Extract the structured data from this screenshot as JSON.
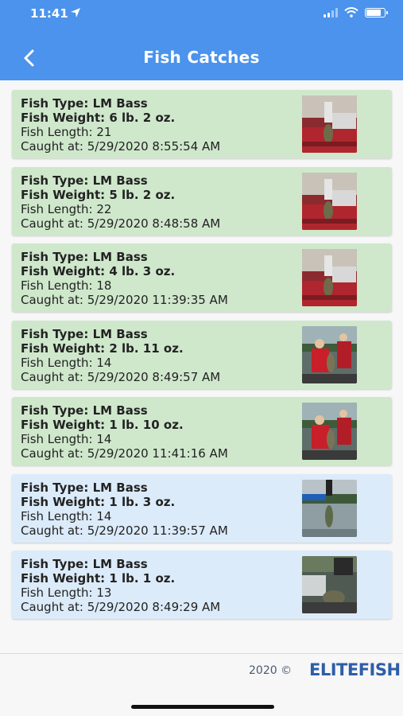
{
  "status": {
    "time": "11:41"
  },
  "header": {
    "title": "Fish Catches"
  },
  "colors": {
    "header": "#4b93ed",
    "card_green": "#cfe8cc",
    "card_blue": "#dcebfa",
    "brand": "#2d5ea8"
  },
  "catches": [
    {
      "type": "Fish Type: LM Bass",
      "weight": "Fish Weight: 6 lb. 2 oz.",
      "length": "Fish Length: 21",
      "caught": "Caught at: 5/29/2020 8:55:54 AM",
      "variant": "green",
      "photo": "fish-on-scale-photo"
    },
    {
      "type": "Fish Type: LM Bass",
      "weight": "Fish Weight: 5 lb. 2 oz.",
      "length": "Fish Length: 22",
      "caught": "Caught at: 5/29/2020 8:48:58 AM",
      "variant": "green",
      "photo": "fish-on-scale-photo"
    },
    {
      "type": "Fish Type: LM Bass",
      "weight": "Fish Weight: 4 lb. 3 oz.",
      "length": "Fish Length: 18",
      "caught": "Caught at: 5/29/2020 11:39:35 AM",
      "variant": "green",
      "photo": "fish-on-scale-photo"
    },
    {
      "type": "Fish Type: LM Bass",
      "weight": "Fish Weight: 2 lb. 11 oz.",
      "length": "Fish Length: 14",
      "caught": "Caught at: 5/29/2020 8:49:57 AM",
      "variant": "green",
      "photo": "angler-with-fish-photo"
    },
    {
      "type": "Fish Type: LM Bass",
      "weight": "Fish Weight: 1 lb. 10 oz.",
      "length": "Fish Length: 14",
      "caught": "Caught at: 5/29/2020 11:41:16 AM",
      "variant": "green",
      "photo": "angler-with-fish-photo"
    },
    {
      "type": "Fish Type: LM Bass",
      "weight": "Fish Weight: 1 lb. 3 oz.",
      "length": "Fish Length: 14",
      "caught": "Caught at: 5/29/2020 11:39:57 AM",
      "variant": "blue",
      "photo": "fish-over-water-photo"
    },
    {
      "type": "Fish Type: LM Bass",
      "weight": "Fish Weight: 1 lb. 1 oz.",
      "length": "Fish Length: 13",
      "caught": "Caught at: 5/29/2020 8:49:29 AM",
      "variant": "blue",
      "photo": "fish-in-boat-photo"
    }
  ],
  "footer": {
    "copyright": "2020 ©",
    "brand": "ELITEFISH"
  }
}
